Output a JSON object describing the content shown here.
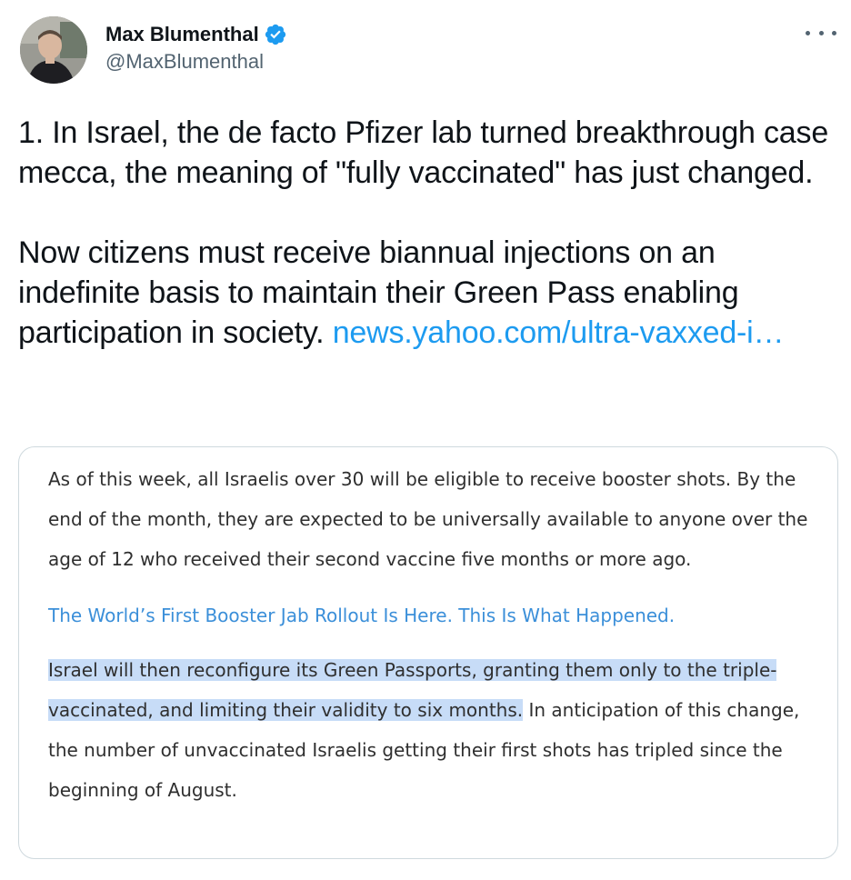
{
  "author": {
    "display_name": "Max Blumenthal",
    "handle": "@MaxBlumenthal",
    "verified": true,
    "accent_color": "#1d9bf0"
  },
  "tweet": {
    "paragraph1": "1. In Israel, the de facto Pfizer lab turned breakthrough case mecca, the meaning of \"fully vaccinated\" has just changed.",
    "paragraph2_text": "Now citizens must receive biannual injections on an indefinite basis to maintain their Green Pass enabling participation in society.",
    "link_text": "news.yahoo.com/ultra-vaxxed-i…"
  },
  "quoted_image": {
    "paragraph1": "As of this week, all Israelis over 30 will be eligible to receive booster shots. By the end of the month, they are expected to be universally available to anyone over the age of 12 who received their second vaccine five months or more ago.",
    "link_line": "The World’s First Booster Jab Rollout Is Here. This Is What Happened.",
    "highlighted_text": "Israel will then reconfigure its Green Passports, granting them only to the triple-vaccinated, and limiting their validity to six months.",
    "rest_text": " In anticipation of this change, the number of unvaccinated Israelis getting their first shots has tripled since the beginning of August."
  },
  "icons": {
    "verified": "verified-badge-icon",
    "more": "more-options-icon"
  }
}
